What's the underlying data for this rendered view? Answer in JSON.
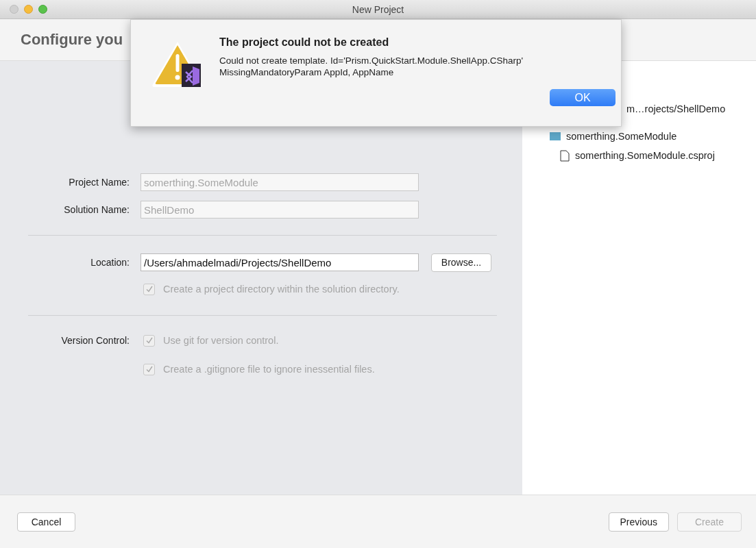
{
  "window": {
    "title": "New Project"
  },
  "header": {
    "title": "Configure you"
  },
  "form": {
    "name_fields": [
      {
        "label": "Project Name:",
        "value": "somerthing.SomeModule",
        "disabled": true
      },
      {
        "label": "Solution Name:",
        "value": "ShellDemo",
        "disabled": true
      }
    ],
    "location": {
      "label": "Location:",
      "value": "/Users/ahmadelmadi/Projects/ShellDemo",
      "disabled": false,
      "browse": "Browse..."
    },
    "location_options": [
      {
        "label": "Create a project directory within the solution directory.",
        "checked": true,
        "disabled": true
      }
    ],
    "version_control": {
      "label": "Version Control:",
      "options": [
        {
          "label": "Use git for version control.",
          "checked": true,
          "disabled": true
        },
        {
          "label": "Create a .gitignore file to ignore inessential files.",
          "checked": true,
          "disabled": true
        }
      ]
    }
  },
  "tree": [
    {
      "label": "m…rojects/ShellDemo",
      "children": [
        {
          "label": "somerthing.SomeModule",
          "kind": "folder",
          "children": [
            {
              "label": "somerthing.SomeModule.csproj",
              "kind": "file"
            }
          ]
        }
      ]
    }
  ],
  "footer": {
    "left_buttons": [
      {
        "label": "Cancel",
        "disabled": false
      }
    ],
    "right_buttons": [
      {
        "label": "Previous",
        "disabled": false
      },
      {
        "label": "Create",
        "disabled": true
      }
    ]
  },
  "dialog": {
    "title": "The project could not be created",
    "message_lines": [
      "Could not create template. Id='Prism.QuickStart.Module.ShellApp.CSharp'",
      "MissingMandatoryParam AppId, AppName"
    ],
    "button": "OK"
  }
}
